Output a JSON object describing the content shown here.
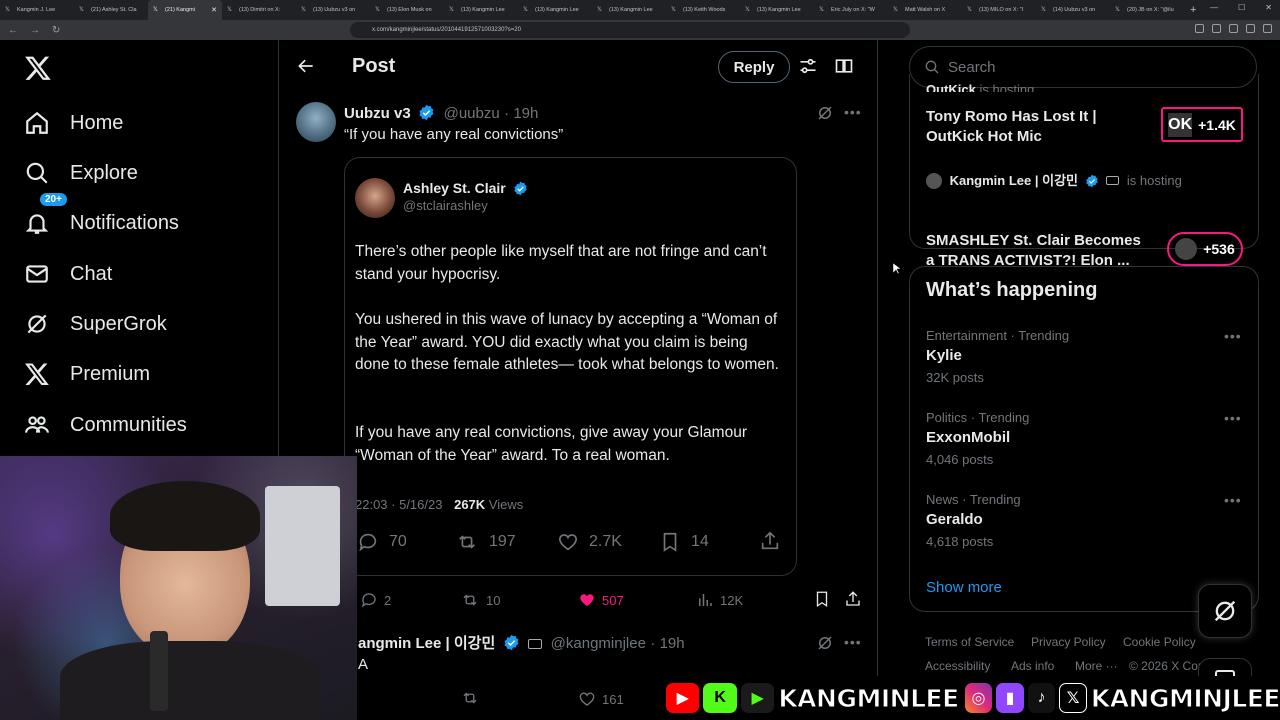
{
  "browser": {
    "tabs": [
      "Kangmin J. Lee",
      "(21) Ashley St. Cla",
      "(21) Kangmi",
      "(13) Dimitri on X:",
      "(13) Uubzu v3 on",
      "(13) Elon Musk on",
      "(13) Kangmin Lee",
      "(13) Kangmin Lee",
      "(13) Kangmin Lee",
      "(13) Keith Woods",
      "(13) Kangmin Lee",
      "Eric July on X: \"W",
      "Matt Walsh on X",
      "(13) MILO on X: \"I",
      "(14) Uubzu v3 on",
      "(20) JB on X: \"@ilu"
    ],
    "active_tab_index": 2,
    "url": "x.com/kangminjlee/status/2010441912571003230?s=20"
  },
  "nav": {
    "items": [
      {
        "label": "Home",
        "icon": "home-icon"
      },
      {
        "label": "Explore",
        "icon": "search-icon"
      },
      {
        "label": "Notifications",
        "icon": "bell-icon"
      },
      {
        "label": "Chat",
        "icon": "mail-icon"
      },
      {
        "label": "SuperGrok",
        "icon": "grok-icon"
      },
      {
        "label": "Premium",
        "icon": "x-logo-icon"
      },
      {
        "label": "Communities",
        "icon": "people-icon"
      }
    ],
    "notif_badge": "20+"
  },
  "header": {
    "title": "Post",
    "reply_label": "Reply"
  },
  "post": {
    "author_name": "Uubzu v3",
    "handle": "@uubzu",
    "time": "19h",
    "text": "“If you have any real convictions”",
    "quote": {
      "author_name": "Ashley St. Clair",
      "handle": "@stclairashley",
      "p1": "There’s other people like myself that are not fringe and can’t stand your hypocrisy.",
      "p2": "You ushered in this wave of lunacy by accepting a “Woman of the Year” award. YOU did exactly what you claim is being done to these female athletes— took what belongs to women.",
      "p3": "If you have any real convictions, give away your Glamour “Woman of the Year” award. To a real woman.",
      "timestamp": "22:03 · 5/16/23",
      "views_count": "267K",
      "views_label": "Views",
      "replies": "70",
      "reposts": "197",
      "likes": "2.7K",
      "bookmarks": "14"
    },
    "stats": {
      "replies": "2",
      "reposts": "10",
      "likes": "507",
      "views": "12K"
    }
  },
  "next_post": {
    "author_name": "angmin Lee | 이강민",
    "handle": "@kangminjlee",
    "time": "19h",
    "text": "A",
    "likes": "161"
  },
  "search": {
    "placeholder": "Search"
  },
  "spaces": {
    "space1": {
      "host_partial": "OutKick",
      "hosting": "is hosting",
      "title": "Tony Romo Has Lost It | OutKick Hot Mic",
      "count": "+1.4K"
    },
    "space2": {
      "host": "Kangmin Lee | 이강민",
      "hosting": "is hosting",
      "title": "SMASHLEY St. Clair Becomes a TRANS ACTIVIST?! Elon ...",
      "count": "+536"
    }
  },
  "trends": {
    "title": "What’s happening",
    "items": [
      {
        "meta": "Entertainment · Trending",
        "name": "Kylie",
        "posts": "32K posts"
      },
      {
        "meta": "Politics · Trending",
        "name": "ExxonMobil",
        "posts": "4,046 posts"
      },
      {
        "meta": "News · Trending",
        "name": "Geraldo",
        "posts": "4,618 posts"
      }
    ],
    "show_more": "Show more"
  },
  "footer": {
    "links": [
      "Terms of Service",
      "Privacy Policy",
      "Cookie Policy",
      "Accessibility",
      "Ads info",
      "More ···",
      "© 2026 X Corp."
    ]
  },
  "overlay": {
    "handle1": "KANGMINLEE",
    "handle2": "KANGMINJLEE"
  },
  "colors": {
    "accent": "#1d9bf0",
    "like": "#f91880",
    "bg": "#000000",
    "border": "#2f3336",
    "muted": "#71767b",
    "space_outkick": "#f91880"
  }
}
